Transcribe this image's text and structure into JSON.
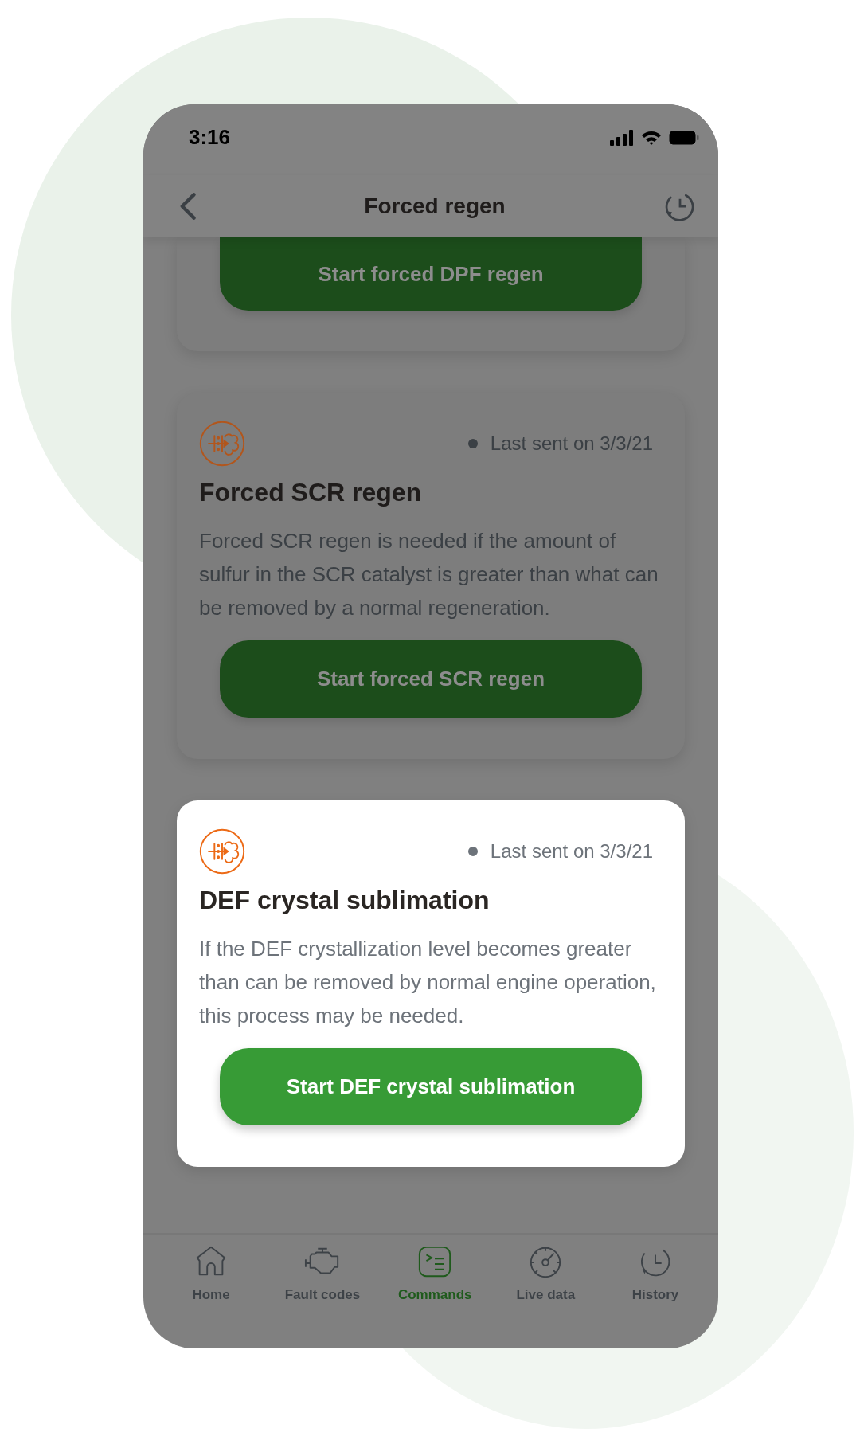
{
  "status_bar": {
    "time": "3:16"
  },
  "header": {
    "title": "Forced regen"
  },
  "cards": [
    {
      "highlighted": false,
      "button": "Start forced DPF regen"
    },
    {
      "highlighted": false,
      "last_sent": "Last sent on 3/3/21",
      "title": "Forced SCR regen",
      "description": "Forced SCR regen is needed if the amount of sulfur in the SCR catalyst is greater than what can be removed by a normal regeneration.",
      "button": "Start forced SCR regen"
    },
    {
      "highlighted": true,
      "last_sent": "Last sent on 3/3/21",
      "title": "DEF crystal sublimation",
      "description": "If the DEF crystallization level becomes greater than can be removed by normal engine operation, this process may be needed.",
      "button": "Start DEF crystal sublimation"
    }
  ],
  "tab_bar": [
    {
      "label": "Home",
      "selected": false
    },
    {
      "label": "Fault codes",
      "selected": false
    },
    {
      "label": "Commands",
      "selected": true
    },
    {
      "label": "Live data",
      "selected": false
    },
    {
      "label": "History",
      "selected": false
    }
  ]
}
